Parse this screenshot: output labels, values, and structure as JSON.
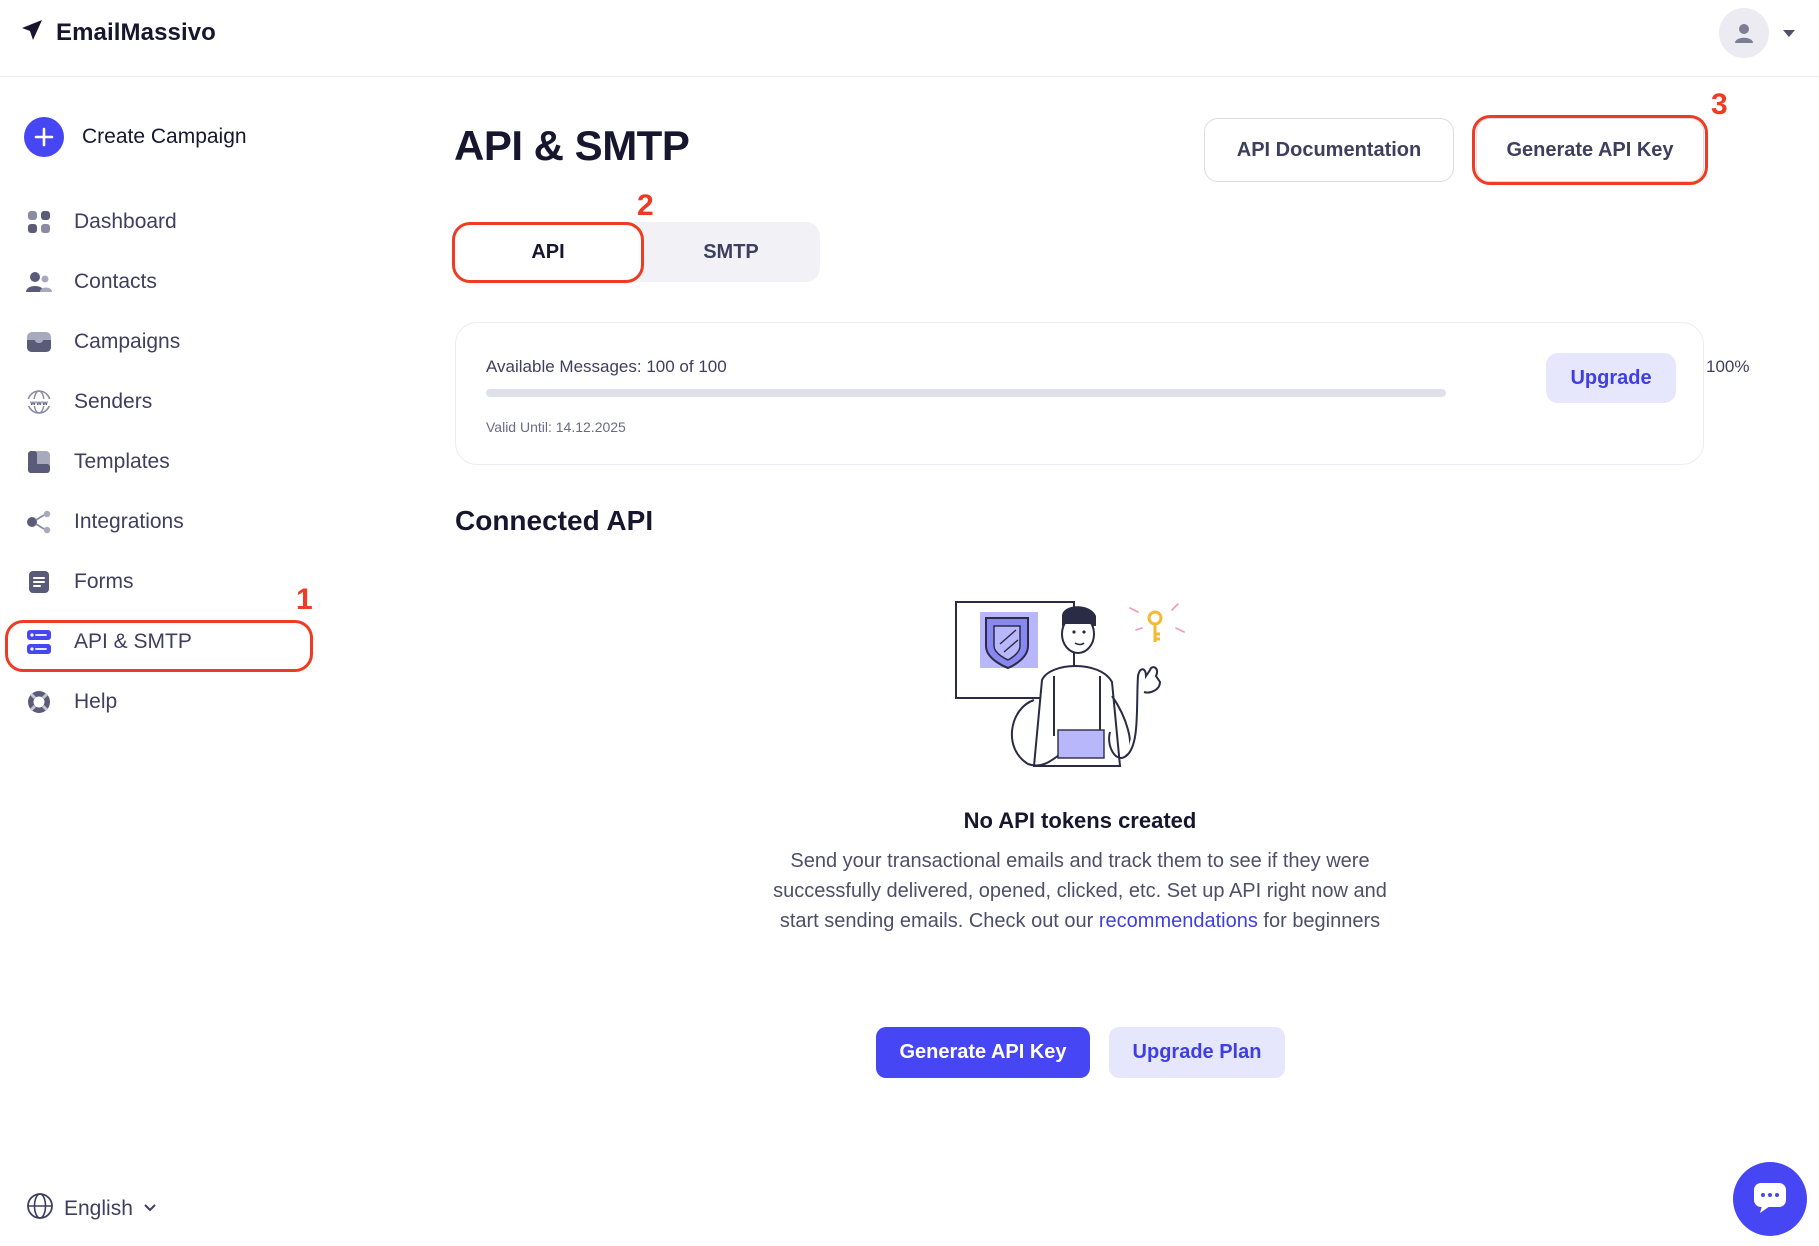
{
  "header": {
    "brand": "EmailMassivo"
  },
  "sidebar": {
    "create_label": "Create Campaign",
    "items": [
      {
        "label": "Dashboard"
      },
      {
        "label": "Contacts"
      },
      {
        "label": "Campaigns"
      },
      {
        "label": "Senders"
      },
      {
        "label": "Templates"
      },
      {
        "label": "Integrations"
      },
      {
        "label": "Forms"
      },
      {
        "label": "API & SMTP",
        "active": true
      },
      {
        "label": "Help"
      }
    ],
    "language": "English"
  },
  "main": {
    "title": "API & SMTP",
    "doc_button": "API Documentation",
    "generate_button": "Generate API Key",
    "tabs": [
      {
        "label": "API",
        "active": true
      },
      {
        "label": "SMTP",
        "active": false
      }
    ],
    "usage": {
      "messages_label": "Available Messages: 100 of 100",
      "percent_label": "100%",
      "progress_fraction": 1.0,
      "valid_until": "Valid Until: 14.12.2025",
      "upgrade_button": "Upgrade"
    },
    "section_title": "Connected API",
    "empty_state": {
      "title": "No API tokens created",
      "text_before": "Send your transactional emails and track them to see if they were successfully delivered, opened, clicked, etc. Set up API right now and start sending emails. Check out our ",
      "link_text": "recommendations",
      "text_after": " for beginners",
      "primary_button": "Generate API Key",
      "secondary_button": "Upgrade Plan"
    }
  },
  "annotations": {
    "one": "1",
    "two": "2",
    "three": "3"
  },
  "colors": {
    "accent": "#4746f4",
    "accent_soft": "#e6e6fd",
    "highlight": "#ef3b24",
    "text_dark": "#16172e"
  }
}
